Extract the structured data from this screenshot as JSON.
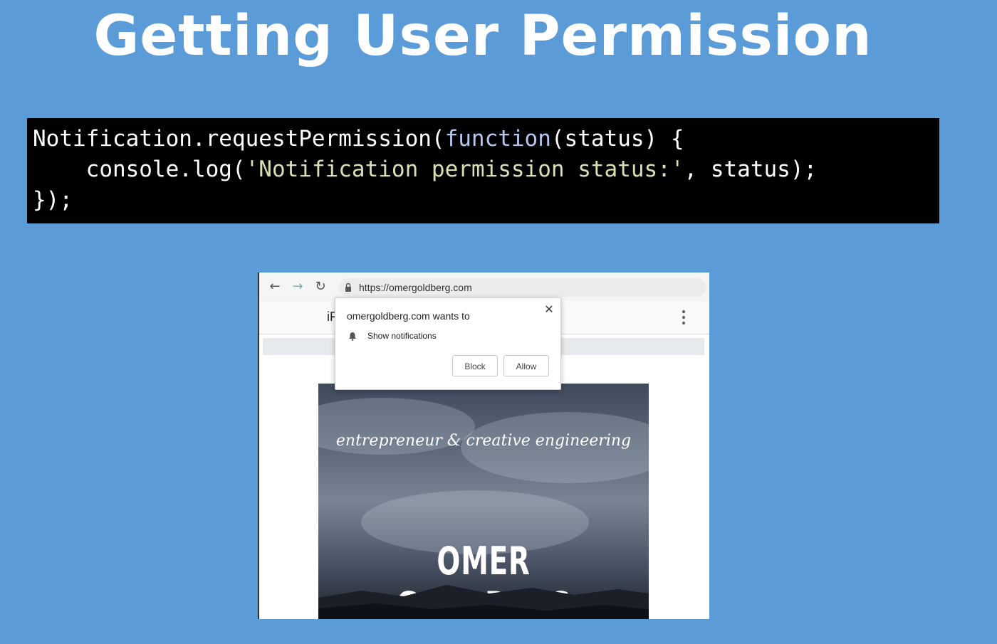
{
  "slide": {
    "title": "Getting User Permission"
  },
  "code": {
    "line1_plain_a": "Notification.requestPermission(",
    "line1_keyword": "function",
    "line1_plain_b": "(status) {",
    "line2_plain_a": "    console.log(",
    "line2_string": "'Notification permission status:'",
    "line2_plain_b": ", status);",
    "line3": "});"
  },
  "browser": {
    "url": "https://omergoldberg.com",
    "site_name_fragment": "iF",
    "icons": {
      "back": "arrow-left-icon",
      "forward": "arrow-right-icon",
      "reload": "reload-icon",
      "lock": "lock-icon",
      "menu": "kebab-menu-icon"
    }
  },
  "permission_dialog": {
    "title": "omergoldberg.com wants to",
    "permission": "Show notifications",
    "block_label": "Block",
    "allow_label": "Allow",
    "close_icon": "close-icon",
    "bell_icon": "bell-icon"
  },
  "hero": {
    "tagline": "entrepreneur & creative engineering",
    "name": "OMER GOLDBERG"
  },
  "colors": {
    "background": "#5b9bd7",
    "code_background": "#000000",
    "code_keyword": "#b7c7ef",
    "code_string": "#d8e0b0"
  }
}
